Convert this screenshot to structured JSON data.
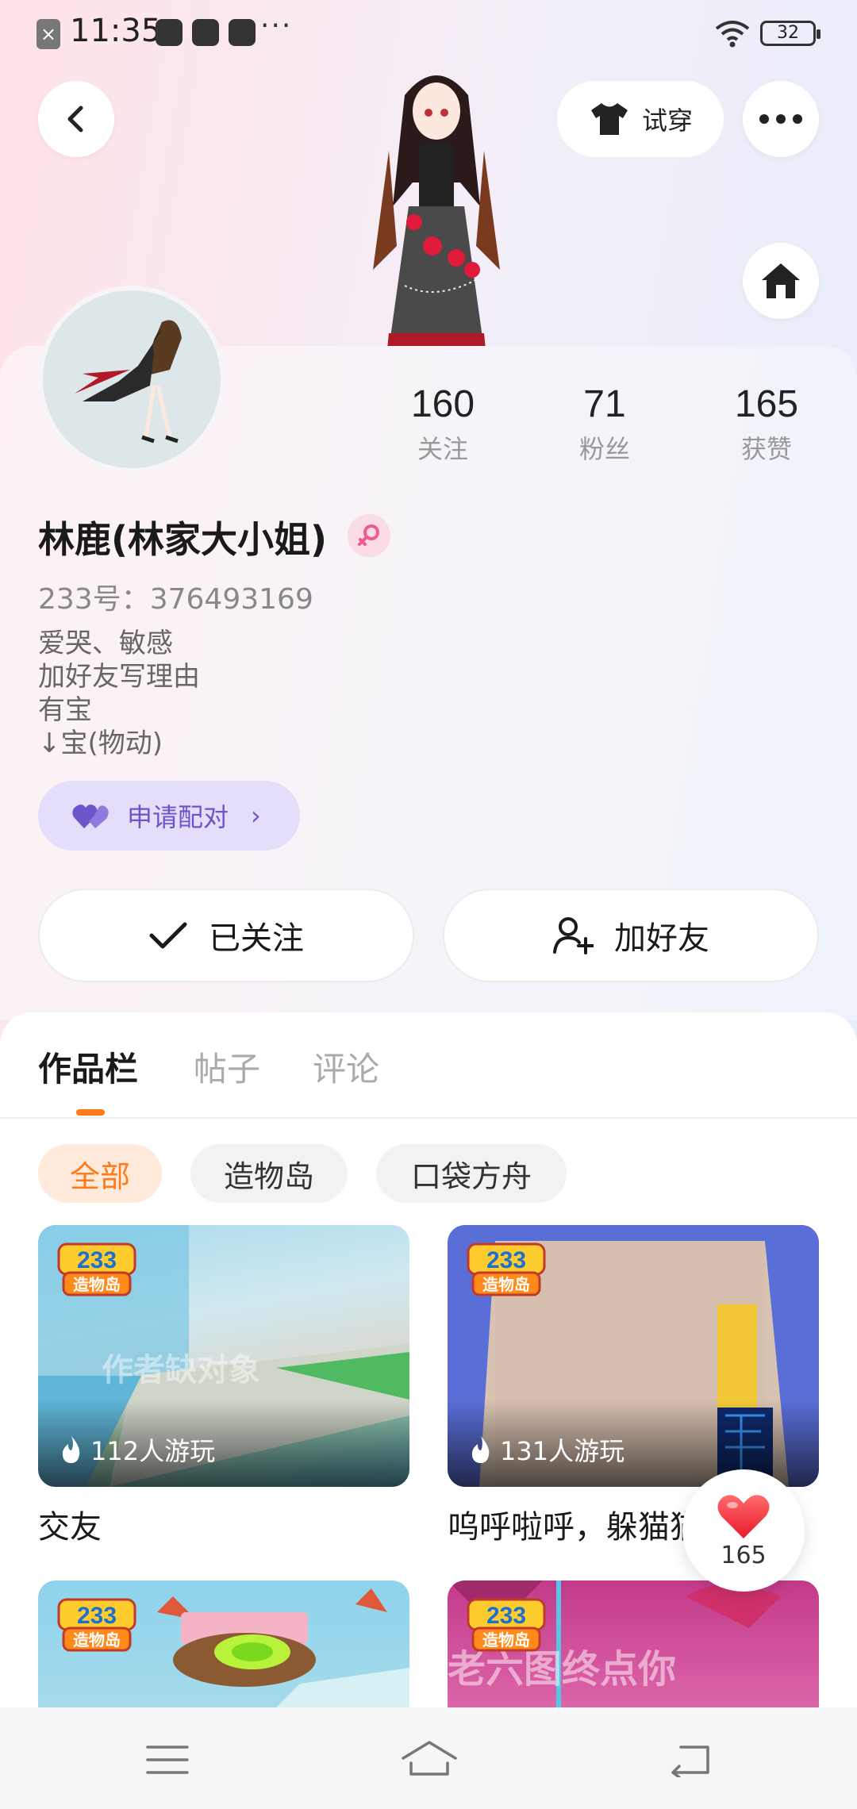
{
  "status_bar": {
    "time": "11:35",
    "dots": "···",
    "battery": "32",
    "left_icon": "notification-x-icon"
  },
  "header": {
    "try_on_label": "试穿"
  },
  "stats": [
    {
      "value": "160",
      "label": "关注"
    },
    {
      "value": "71",
      "label": "粉丝"
    },
    {
      "value": "165",
      "label": "获赞"
    }
  ],
  "profile": {
    "nickname": "林鹿(林家大小姐)",
    "uid": "233号：376493169",
    "bio_lines": [
      "爱哭、敏感",
      "加好友写理由",
      "有宝",
      "↓宝(物动)"
    ]
  },
  "pair_button": {
    "label": "申请配对"
  },
  "actions": {
    "followed_label": "已关注",
    "add_friend_label": "加好友"
  },
  "tabs": [
    {
      "label": "作品栏",
      "active": true
    },
    {
      "label": "帖子",
      "active": false
    },
    {
      "label": "评论",
      "active": false
    }
  ],
  "filters": [
    {
      "label": "全部",
      "active": true
    },
    {
      "label": "造物岛",
      "active": false
    },
    {
      "label": "口袋方舟",
      "active": false
    }
  ],
  "works": [
    {
      "title": "交友",
      "plays": "112人游玩",
      "badge_top": "233",
      "badge_bottom": "造物岛",
      "watermark": "作者缺对象"
    },
    {
      "title": "呜呼啦呼，躲猫猫",
      "plays": "131人游玩",
      "badge_top": "233",
      "badge_bottom": "造物岛",
      "watermark": ""
    },
    {
      "title": "",
      "plays": "",
      "badge_top": "233",
      "badge_bottom": "造物岛",
      "watermark": ""
    },
    {
      "title": "",
      "plays": "",
      "badge_top": "233",
      "badge_bottom": "造物岛",
      "watermark": "老六图终点你"
    }
  ],
  "like_fab": {
    "count": "165"
  },
  "colors": {
    "accent_orange": "#ff7a1a",
    "pair_purple": "#6c54c9",
    "heart_red": "#f0303a",
    "pink_badge": "#fbdbe5"
  }
}
